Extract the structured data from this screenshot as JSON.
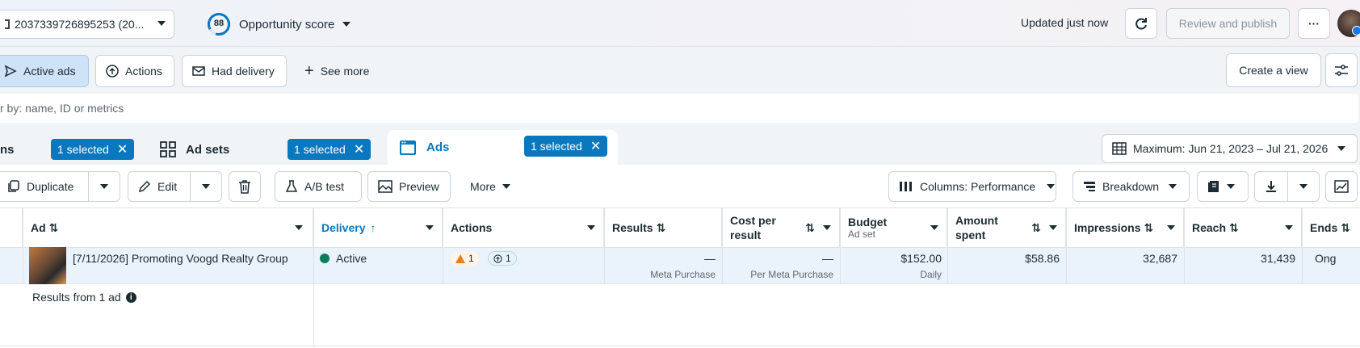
{
  "topbar": {
    "account": "2037339726895253 (20...",
    "score_value": "88",
    "score_label": "Opportunity score",
    "updated": "Updated just now",
    "review_publish": "Review and publish",
    "more": "···"
  },
  "filters": {
    "active_ads": "Active ads",
    "actions": "Actions",
    "had_delivery": "Had delivery",
    "see_more": "See more",
    "create_view": "Create a view"
  },
  "search": {
    "placeholder": "r by: name, ID or metrics"
  },
  "tabs": {
    "campaigns_partial": "ns",
    "campaigns_selected": "1 selected",
    "adsets": "Ad sets",
    "adsets_selected": "1 selected",
    "ads": "Ads",
    "ads_selected": "1 selected",
    "date_range": "Maximum: Jun 21, 2023 – Jul 21, 2026"
  },
  "toolbar": {
    "duplicate": "Duplicate",
    "edit": "Edit",
    "ab_test": "A/B test",
    "preview": "Preview",
    "more": "More",
    "columns": "Columns: Performance",
    "breakdown": "Breakdown"
  },
  "table": {
    "headers": {
      "ad": "Ad",
      "delivery": "Delivery",
      "actions": "Actions",
      "results": "Results",
      "cost_per_result": "Cost per result",
      "budget": "Budget",
      "budget_sub": "Ad set",
      "amount_spent": "Amount spent",
      "impressions": "Impressions",
      "reach": "Reach",
      "ends": "Ends"
    },
    "row": {
      "name": "[7/11/2026] Promoting Voogd Realty Group",
      "delivery": "Active",
      "warn_count": "1",
      "action_count": "1",
      "results": "—",
      "results_sub": "Meta Purchase",
      "cost": "—",
      "cost_sub": "Per Meta Purchase",
      "budget": "$152.00",
      "budget_sub": "Daily",
      "spent": "$58.86",
      "impressions": "32,687",
      "reach": "31,439",
      "ends": "Ong"
    },
    "footer": "Results from 1 ad"
  },
  "colors": {
    "accent": "#0a78be",
    "active_green": "#0a7e5a",
    "warn": "#e6821e"
  }
}
